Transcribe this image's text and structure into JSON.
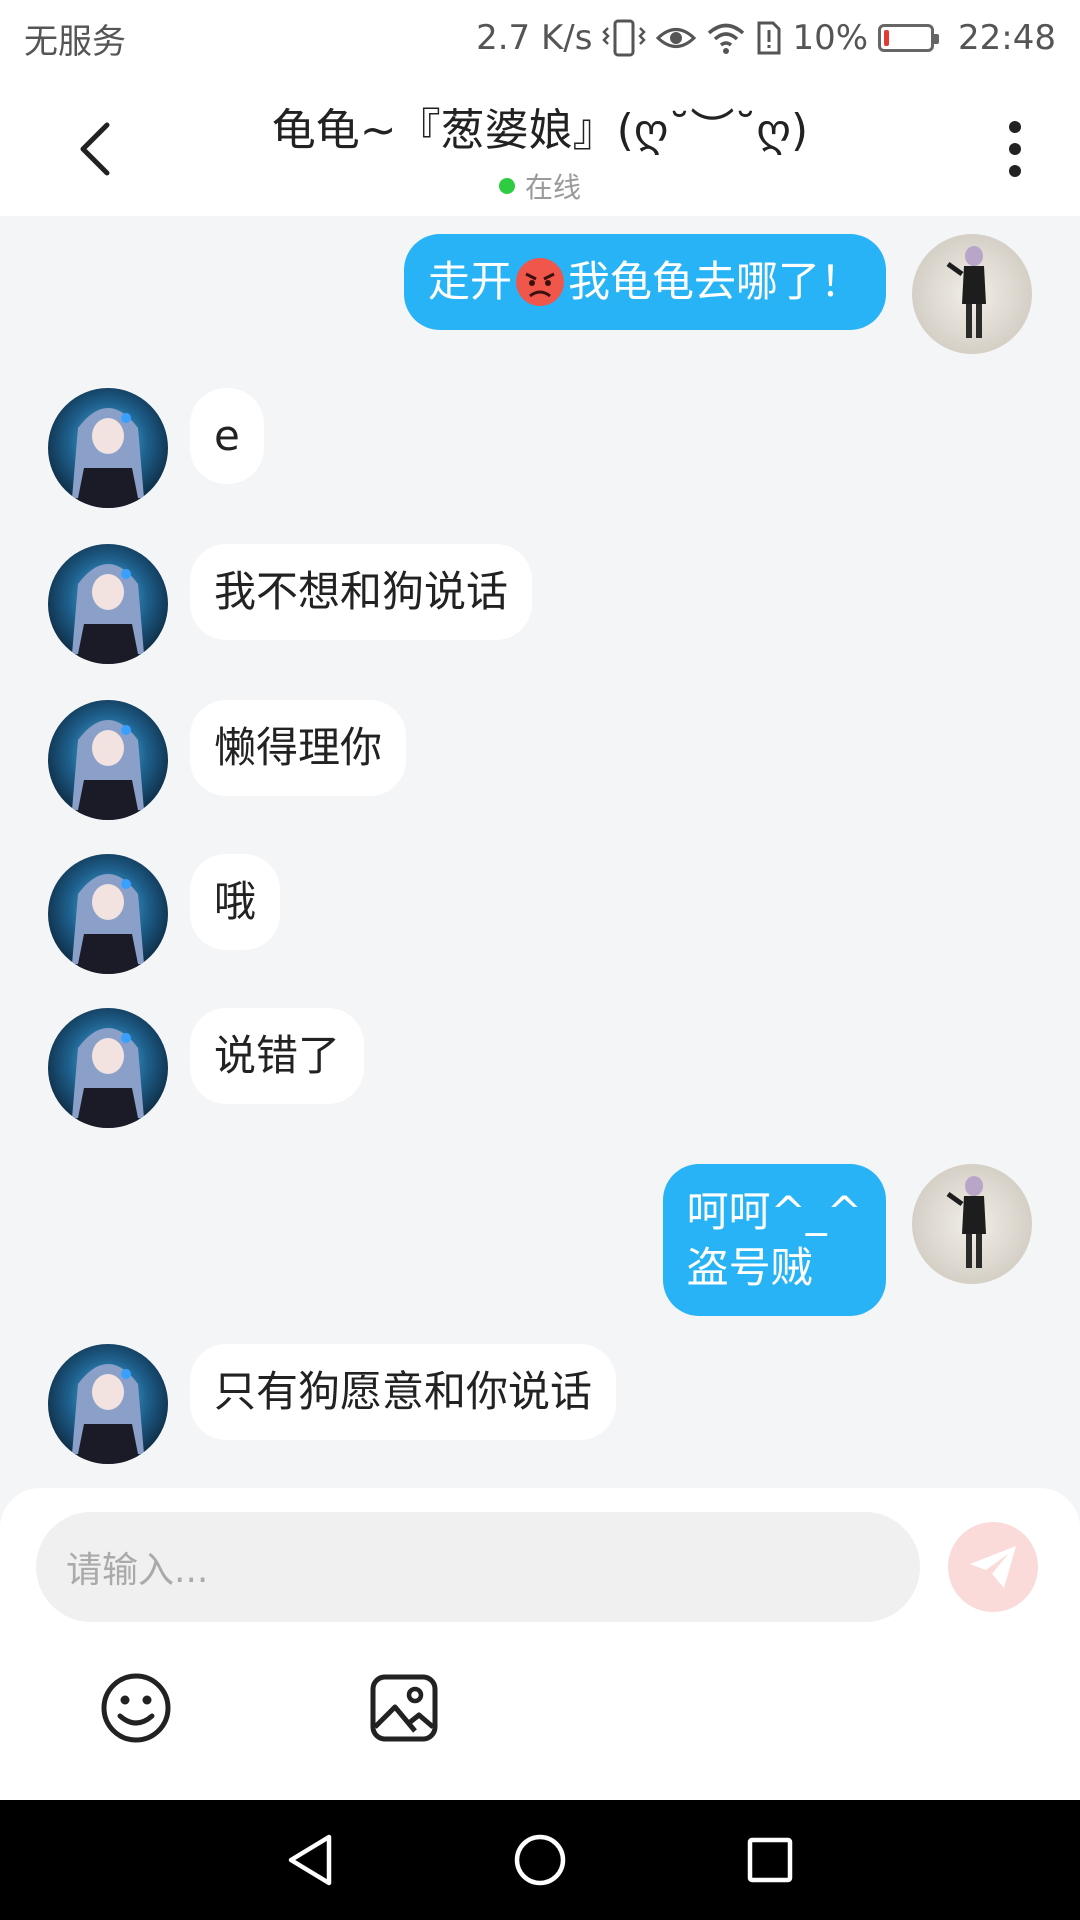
{
  "status_bar": {
    "carrier": "无服务",
    "network_speed": "2.7 K/s",
    "battery_percent": "10%",
    "time": "22:48",
    "battery_level": 0.1,
    "icons": [
      "vibrate-icon",
      "eye-icon",
      "wifi-icon",
      "sim-alert-icon",
      "battery-icon"
    ]
  },
  "header": {
    "title": "龟龟~『葱婆娘』(ღ˘︶˘ღ)",
    "status": "在线",
    "back_icon": "chevron-left-icon",
    "more_icon": "more-vertical-icon"
  },
  "messages": [
    {
      "direction": "out",
      "pre": "走开",
      "emoji": "angry-face-emoji",
      "post": "我龟龟去哪了！"
    },
    {
      "direction": "in",
      "text": "e"
    },
    {
      "direction": "in",
      "text": "我不想和狗说话"
    },
    {
      "direction": "in",
      "text": "懒得理你"
    },
    {
      "direction": "in",
      "text": "哦"
    },
    {
      "direction": "in",
      "text": "说错了"
    },
    {
      "direction": "out",
      "line1": "呵呵^_^",
      "line2": "盗号贼"
    },
    {
      "direction": "in",
      "text": "只有狗愿意和你说话"
    }
  ],
  "input": {
    "placeholder": "请输入...",
    "send_icon": "send-icon",
    "tools": [
      "emoji-icon",
      "image-icon"
    ]
  },
  "colors": {
    "outgoing_bubble": "#27b3f5",
    "incoming_bubble": "#ffffff",
    "online": "#2ecc40",
    "send_button": "#fbdada",
    "background": "#f4f5f7"
  },
  "nav": [
    "back-triangle-icon",
    "home-circle-icon",
    "recents-square-icon"
  ]
}
